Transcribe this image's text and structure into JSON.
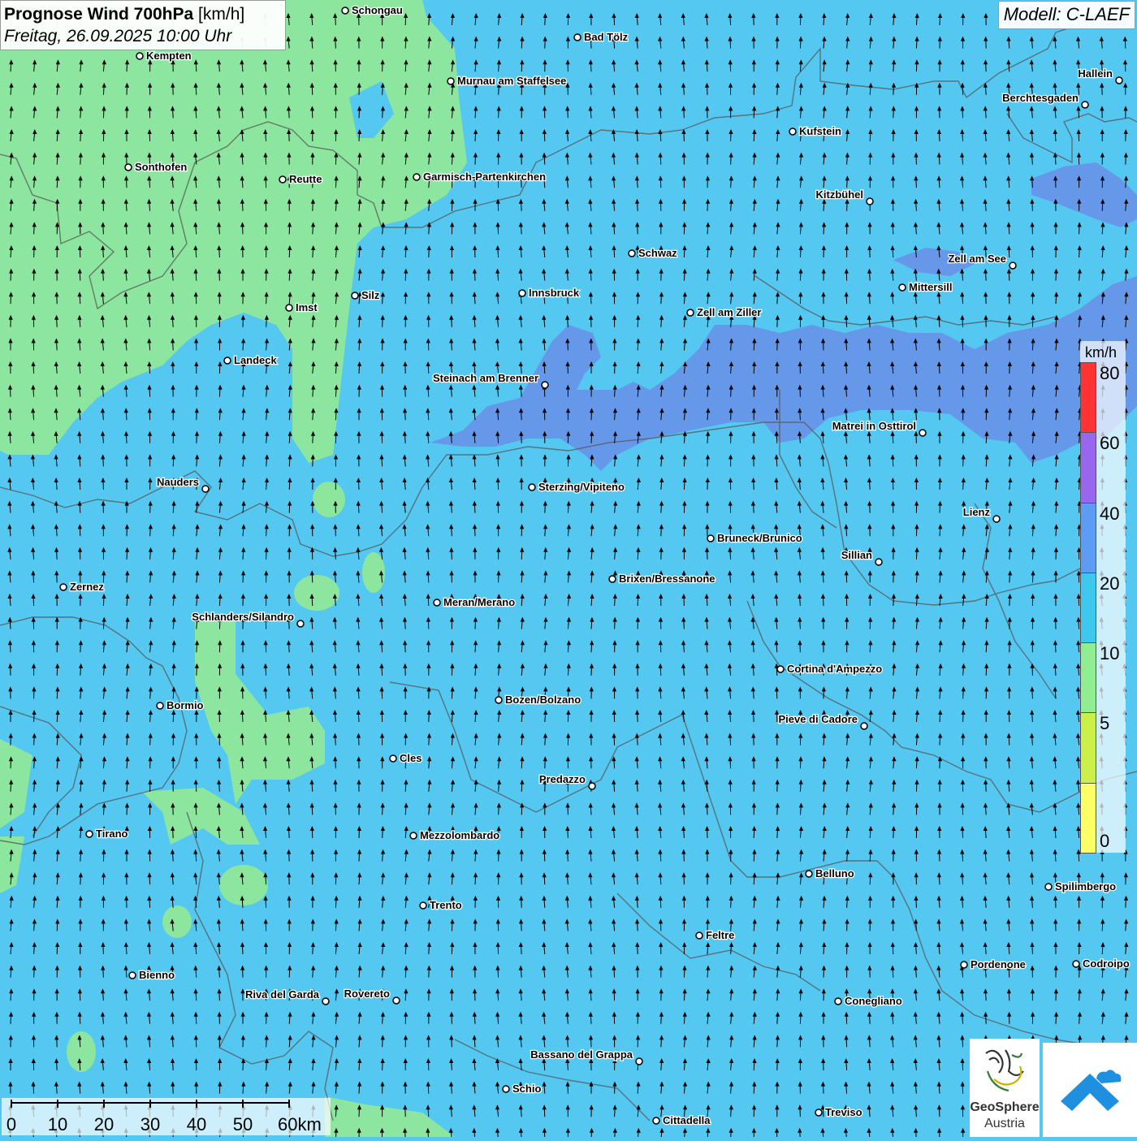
{
  "header": {
    "title_bold": "Prognose Wind 700hPa",
    "title_unit": "[km/h]",
    "datetime": "Freitag, 26.09.2025 10:00 Uhr"
  },
  "model": "Modell: C-LAEF",
  "legend": {
    "unit": "km/h",
    "ticks": [
      "0",
      "5",
      "10",
      "20",
      "40",
      "60",
      "80"
    ],
    "colors": [
      "#ffff66",
      "#ccf04a",
      "#90ee90",
      "#3ec8f0",
      "#5c9cf5",
      "#9966ee",
      "#ff3333"
    ]
  },
  "wind": {
    "direction": "from south (arrows pointing north)",
    "range_kmh": "10-60"
  },
  "cities": [
    {
      "name": "Schongau"
    },
    {
      "name": "Bad Tölz"
    },
    {
      "name": "Kempten"
    },
    {
      "name": "Murnau am Staffelsee"
    },
    {
      "name": "Hallein"
    },
    {
      "name": "Berchtesgaden"
    },
    {
      "name": "Kufstein"
    },
    {
      "name": "Sonthofen"
    },
    {
      "name": "Reutte"
    },
    {
      "name": "Garmisch-Partenkirchen"
    },
    {
      "name": "Kitzbühel"
    },
    {
      "name": "Schwaz"
    },
    {
      "name": "Zell am See"
    },
    {
      "name": "Imst"
    },
    {
      "name": "Silz"
    },
    {
      "name": "Innsbruck"
    },
    {
      "name": "Mittersill"
    },
    {
      "name": "Zell am Ziller"
    },
    {
      "name": "Landeck"
    },
    {
      "name": "Steinach am Brenner"
    },
    {
      "name": "Matrei in Osttirol"
    },
    {
      "name": "Nauders"
    },
    {
      "name": "Sterzing/Vipiteno"
    },
    {
      "name": "Lienz"
    },
    {
      "name": "Bruneck/Brunico"
    },
    {
      "name": "Sillian"
    },
    {
      "name": "Zernez"
    },
    {
      "name": "Brixen/Bressanone"
    },
    {
      "name": "Meran/Merano"
    },
    {
      "name": "Schlanders/Silandro"
    },
    {
      "name": "Cortina d'Ampezzo"
    },
    {
      "name": "Bozen/Bolzano"
    },
    {
      "name": "Bormio"
    },
    {
      "name": "Pieve di Cadore"
    },
    {
      "name": "Cles"
    },
    {
      "name": "Predazzo"
    },
    {
      "name": "Tirano"
    },
    {
      "name": "Mezzolombardo"
    },
    {
      "name": "Belluno"
    },
    {
      "name": "Spilimbergo"
    },
    {
      "name": "Trento"
    },
    {
      "name": "Feltre"
    },
    {
      "name": "Pordenone"
    },
    {
      "name": "Codroipo"
    },
    {
      "name": "Bienno"
    },
    {
      "name": "Riva del Garda"
    },
    {
      "name": "Rovereto"
    },
    {
      "name": "Conegliano"
    },
    {
      "name": "Bassano del Grappa"
    },
    {
      "name": "Schio"
    },
    {
      "name": "Treviso"
    },
    {
      "name": "Cittadella"
    }
  ],
  "scalebar": {
    "ticks": [
      "0",
      "10",
      "20",
      "30",
      "40",
      "50",
      "60km"
    ]
  },
  "logo": {
    "line1": "GeoSphere",
    "line2": "Austria"
  }
}
